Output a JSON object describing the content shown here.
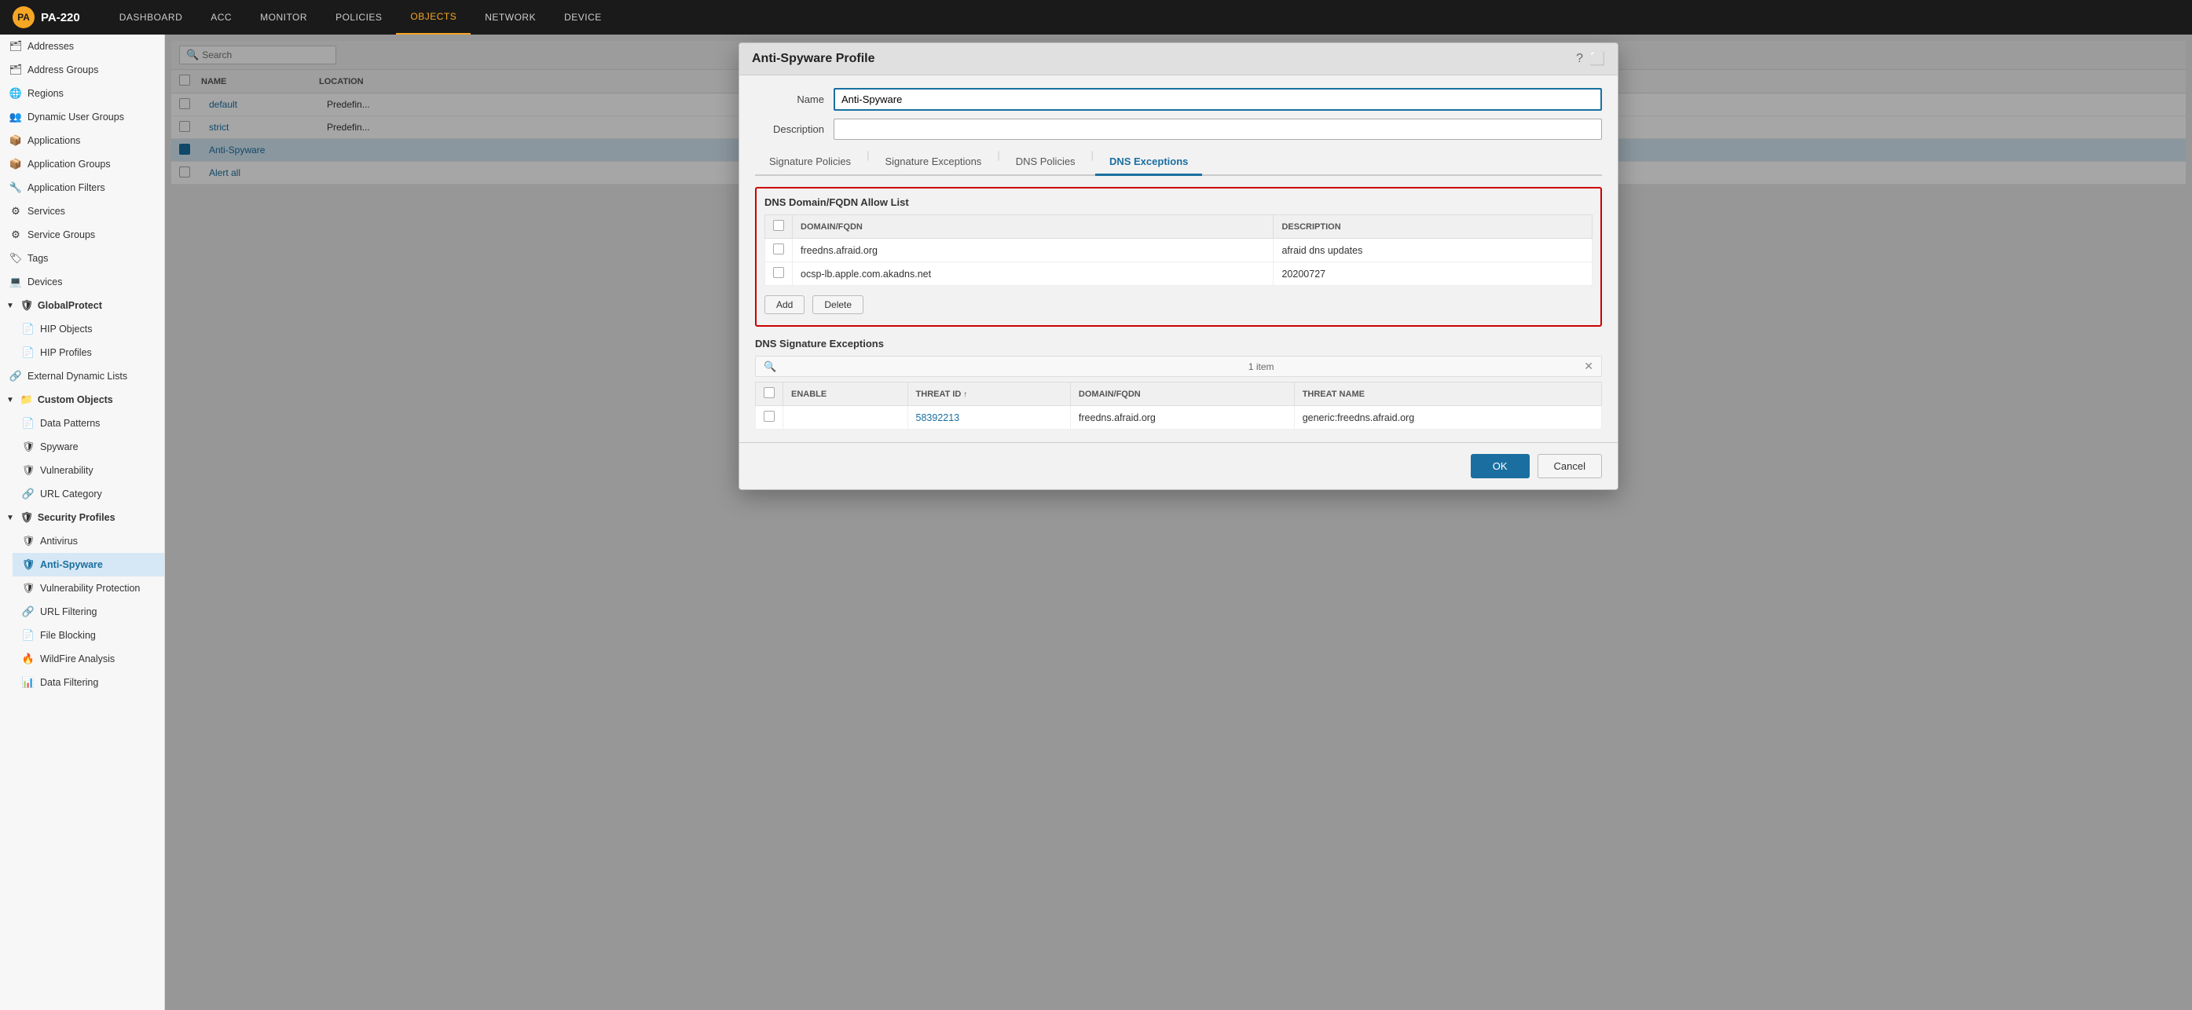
{
  "brand": {
    "icon": "PA",
    "name": "PA-220"
  },
  "nav": {
    "items": [
      {
        "label": "DASHBOARD",
        "active": false
      },
      {
        "label": "ACC",
        "active": false
      },
      {
        "label": "MONITOR",
        "active": false
      },
      {
        "label": "POLICIES",
        "active": false
      },
      {
        "label": "OBJECTS",
        "active": true
      },
      {
        "label": "NETWORK",
        "active": false
      },
      {
        "label": "DEVICE",
        "active": false
      }
    ]
  },
  "sidebar": {
    "items": [
      {
        "label": "Addresses",
        "icon": "🗂",
        "indent": 0
      },
      {
        "label": "Address Groups",
        "icon": "🗂",
        "indent": 0
      },
      {
        "label": "Regions",
        "icon": "🌐",
        "indent": 0
      },
      {
        "label": "Dynamic User Groups",
        "icon": "👥",
        "indent": 0
      },
      {
        "label": "Applications",
        "icon": "📦",
        "indent": 0
      },
      {
        "label": "Application Groups",
        "icon": "📦",
        "indent": 0
      },
      {
        "label": "Application Filters",
        "icon": "🔧",
        "indent": 0
      },
      {
        "label": "Services",
        "icon": "⚙",
        "indent": 0
      },
      {
        "label": "Service Groups",
        "icon": "⚙",
        "indent": 0
      },
      {
        "label": "Tags",
        "icon": "🏷",
        "indent": 0
      },
      {
        "label": "Devices",
        "icon": "💻",
        "indent": 0
      },
      {
        "label": "GlobalProtect",
        "icon": "🛡",
        "indent": 0,
        "expanded": true
      },
      {
        "label": "HIP Objects",
        "icon": "📄",
        "indent": 1
      },
      {
        "label": "HIP Profiles",
        "icon": "📄",
        "indent": 1
      },
      {
        "label": "External Dynamic Lists",
        "icon": "🔗",
        "indent": 0
      },
      {
        "label": "Custom Objects",
        "icon": "📁",
        "indent": 0,
        "expanded": true
      },
      {
        "label": "Data Patterns",
        "icon": "📄",
        "indent": 1
      },
      {
        "label": "Spyware",
        "icon": "🛡",
        "indent": 1
      },
      {
        "label": "Vulnerability",
        "icon": "🛡",
        "indent": 1
      },
      {
        "label": "URL Category",
        "icon": "🔗",
        "indent": 1
      },
      {
        "label": "Security Profiles",
        "icon": "🛡",
        "indent": 0,
        "expanded": true
      },
      {
        "label": "Antivirus",
        "icon": "🛡",
        "indent": 1
      },
      {
        "label": "Anti-Spyware",
        "icon": "🛡",
        "indent": 1,
        "active": true
      },
      {
        "label": "Vulnerability Protection",
        "icon": "🛡",
        "indent": 1
      },
      {
        "label": "URL Filtering",
        "icon": "🔗",
        "indent": 1
      },
      {
        "label": "File Blocking",
        "icon": "📄",
        "indent": 1
      },
      {
        "label": "WildFire Analysis",
        "icon": "🔥",
        "indent": 1
      },
      {
        "label": "Data Filtering",
        "icon": "📊",
        "indent": 1
      }
    ]
  },
  "bg_table": {
    "search_placeholder": "Search",
    "columns": [
      "NAME",
      "LOCATION"
    ],
    "rows": [
      {
        "name": "default",
        "location": "Predefin...",
        "selected": false
      },
      {
        "name": "strict",
        "location": "Predefin...",
        "selected": false
      },
      {
        "name": "Anti-Spyware",
        "location": "",
        "selected": true
      },
      {
        "name": "Alert all",
        "location": "",
        "selected": false
      }
    ]
  },
  "modal": {
    "title": "Anti-Spyware Profile",
    "name_label": "Name",
    "name_value": "Anti-Spyware",
    "description_label": "Description",
    "description_value": "",
    "tabs": [
      {
        "label": "Signature Policies",
        "active": false
      },
      {
        "label": "Signature Exceptions",
        "active": false
      },
      {
        "label": "DNS Policies",
        "active": false
      },
      {
        "label": "DNS Exceptions",
        "active": true
      }
    ],
    "dns_domain_section": {
      "title": "DNS Domain/FQDN Allow List",
      "columns": [
        "DOMAIN/FQDN",
        "DESCRIPTION"
      ],
      "rows": [
        {
          "domain": "freedns.afraid.org",
          "description": "afraid dns updates"
        },
        {
          "domain": "ocsp-lb.apple.com.akadns.net",
          "description": "20200727"
        }
      ],
      "add_btn": "Add",
      "delete_btn": "Delete"
    },
    "dns_signature_section": {
      "title": "DNS Signature Exceptions",
      "search_placeholder": "",
      "count": "1 item",
      "columns": [
        {
          "label": "ENABLE",
          "sortable": false
        },
        {
          "label": "THREAT ID",
          "sortable": true
        },
        {
          "label": "DOMAIN/FQDN",
          "sortable": false
        },
        {
          "label": "THREAT NAME",
          "sortable": false
        }
      ],
      "rows": [
        {
          "enable": false,
          "threat_id": "58392213",
          "domain": "freedns.afraid.org",
          "threat_name": "generic:freedns.afraid.org"
        }
      ]
    },
    "ok_btn": "OK",
    "cancel_btn": "Cancel"
  }
}
